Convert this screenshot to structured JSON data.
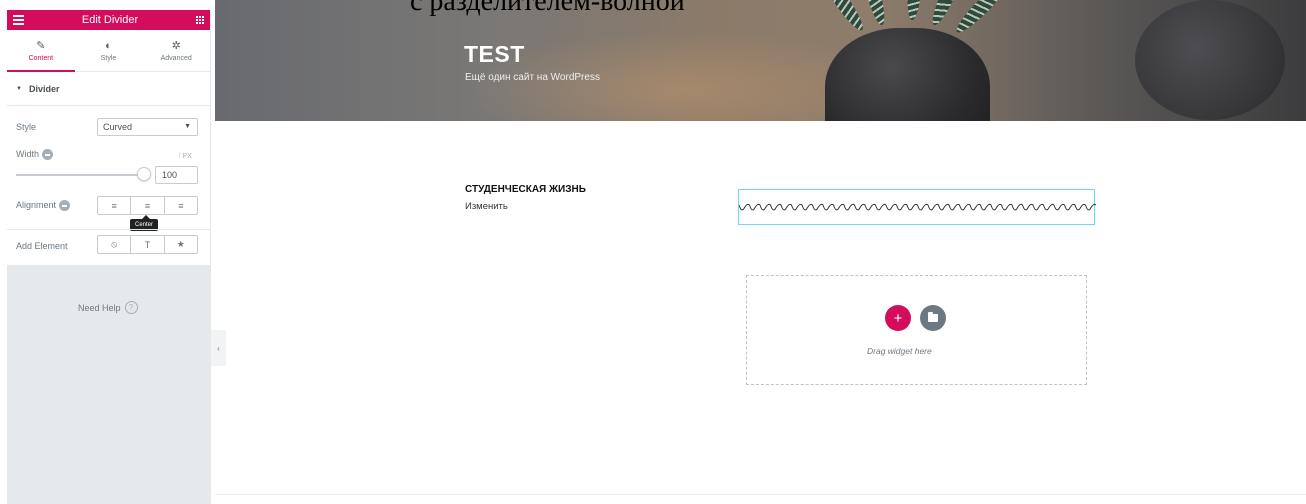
{
  "document": {
    "caption": "с разделителем-волной"
  },
  "panel": {
    "header_title": "Edit Divider",
    "tabs": [
      {
        "label": "Content",
        "icon": "pencil-icon"
      },
      {
        "label": "Style",
        "icon": "contrast-icon"
      },
      {
        "label": "Advanced",
        "icon": "gear-icon"
      }
    ],
    "active_tab": "Content",
    "section_title": "Divider",
    "controls": {
      "style_label": "Style",
      "style_value": "Curved",
      "width_label": "Width",
      "width_unit": "PX",
      "width_value": "100",
      "alignment_label": "Alignment",
      "alignment_options": [
        "≡",
        "≡",
        "≡"
      ],
      "alignment_selected": "Center",
      "alignment_tooltip": "Center",
      "add_element_label": "Add Element",
      "add_element_options": [
        "⦸",
        "T",
        "★"
      ]
    },
    "need_help": "Need Help",
    "accent_color": "#d30c5c"
  },
  "site": {
    "title": "TEST",
    "tagline": "Ещё один сайт на WordPress"
  },
  "content": {
    "heading": "СТУДЕНЧЕСКАЯ ЖИЗНЬ",
    "edit_link": "Изменить",
    "dropzone_text": "Drag widget here",
    "add_button": "+"
  }
}
